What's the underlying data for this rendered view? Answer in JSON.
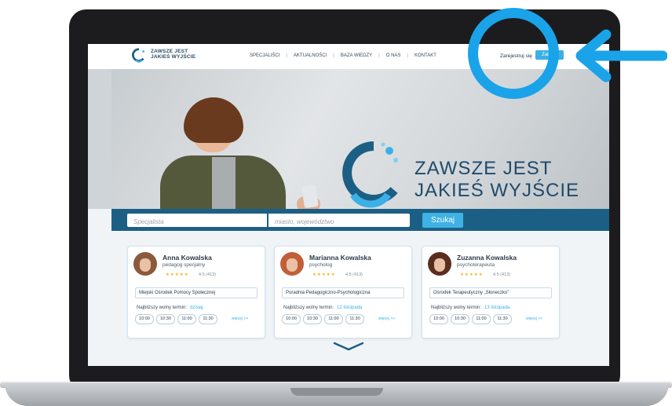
{
  "header": {
    "logo_line1": "ZAWSZE JEST",
    "logo_line2": "JAKIEŚ WYJŚCIE",
    "nav": [
      "SPECJALIŚCI",
      "AKTUALNOŚCI",
      "BAZA WIEDZY",
      "O NAS",
      "KONTAKT"
    ],
    "nav_sep": "|",
    "register": "Zarejestruj się",
    "login": "Zaloguj"
  },
  "hero": {
    "title_line1": "ZAWSZE JEST",
    "title_line2": "JAKIEŚ WYJŚCIE"
  },
  "search": {
    "specialist_placeholder": "Specjalista",
    "city_placeholder": "miasto, województwo",
    "button": "Szukaj"
  },
  "cards": [
    {
      "name": "Anna Kowalska",
      "role": "pedagog specjalny",
      "stars": "★★★★★",
      "rating": "4.5 (413)",
      "place": "Miejski Ośrodek Pomocy Społecznej",
      "next_label": "Najbliższy wolny termin:",
      "next_value": "dzisiaj",
      "slots": [
        "10:00",
        "10:30",
        "11:00",
        "11:30"
      ],
      "more": "więcej >>"
    },
    {
      "name": "Marianna Kowalska",
      "role": "psycholog",
      "stars": "★★★★★",
      "rating": "4.5 (413)",
      "place": "Poradnia Pedagogiczno-Psychologiczna",
      "next_label": "Najbliższy wolny termin:",
      "next_value": "12 listopada",
      "slots": [
        "10:00",
        "10:30",
        "11:00",
        "11:30"
      ],
      "more": "więcej >>"
    },
    {
      "name": "Zuzanna Kowalska",
      "role": "psychoterapeuta",
      "stars": "★★★★★",
      "rating": "4.5 (413)",
      "place": "Ośrodek Terapeutyczny „Słoneczko”",
      "next_label": "Najbliższy wolny termin:",
      "next_value": "13 listopada",
      "slots": [
        "10:00",
        "10:30",
        "11:00",
        "11:30"
      ],
      "more": "więcej >>"
    }
  ],
  "colors": {
    "accent": "#3bb0e6",
    "highlight": "#1aa3e8",
    "searchbar": "#1c5f85",
    "title": "#1f4a6b"
  },
  "icons": {
    "logo": "logo-icon",
    "scroll": "chevron-down-icon",
    "annotation_arrow": "arrow-left-icon",
    "annotation_circle": "highlight-circle-icon"
  }
}
